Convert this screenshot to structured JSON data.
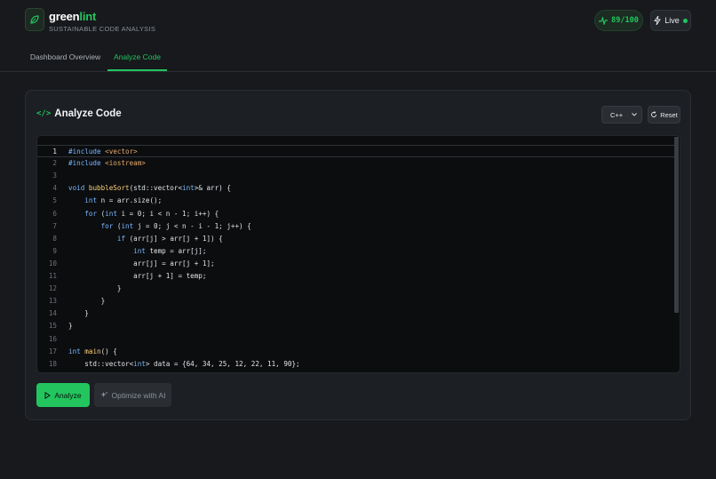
{
  "app": {
    "brand_part1": "green",
    "brand_part2": "lint",
    "tagline": "SUSTAINABLE CODE ANALYSIS",
    "score": "89/100",
    "live_label": "Live"
  },
  "tabs": [
    {
      "label": "Dashboard Overview",
      "active": false
    },
    {
      "label": "Analyze Code",
      "active": true
    }
  ],
  "panel": {
    "title": "Analyze Code",
    "language": "C++",
    "reset_label": "Reset",
    "analyze_label": "Analyze",
    "optimize_label": "Optimize with AI"
  },
  "editor": {
    "active_line": 1,
    "lines": [
      "#include <vector>",
      "#include <iostream>",
      "",
      "void bubbleSort(std::vector<int>& arr) {",
      "    int n = arr.size();",
      "    for (int i = 0; i < n - 1; i++) {",
      "        for (int j = 0; j < n - i - 1; j++) {",
      "            if (arr[j] > arr[j + 1]) {",
      "                int temp = arr[j];",
      "                arr[j] = arr[j + 1];",
      "                arr[j + 1] = temp;",
      "            }",
      "        }",
      "    }",
      "}",
      "",
      "int main() {",
      "    std::vector<int> data = {64, 34, 25, 12, 22, 11, 90};"
    ]
  },
  "colors": {
    "accent": "#22c55e",
    "background": "#17191c",
    "panel": "#1c1f23",
    "editor": "#0c0d0f"
  }
}
